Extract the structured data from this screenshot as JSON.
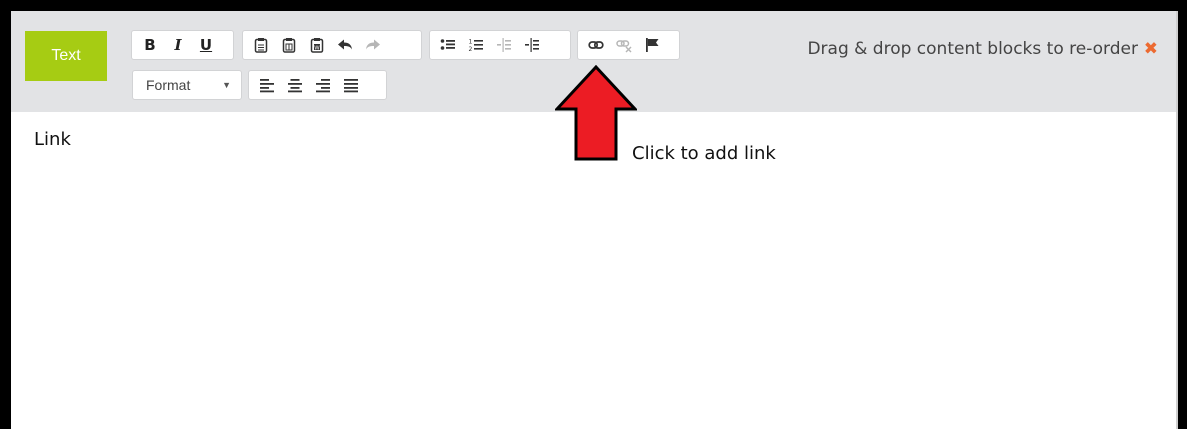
{
  "block": {
    "type_label": "Text"
  },
  "toolbar": {
    "format_label": "Format",
    "buttons": [
      {
        "name": "bold",
        "icon": "bold-icon",
        "glyph": "B"
      },
      {
        "name": "italic",
        "icon": "italic-icon",
        "glyph": "I"
      },
      {
        "name": "underline",
        "icon": "underline-icon",
        "glyph": "U"
      },
      {
        "name": "paste",
        "icon": "paste-icon"
      },
      {
        "name": "paste-text",
        "icon": "paste-text-icon"
      },
      {
        "name": "paste-word",
        "icon": "paste-word-icon"
      },
      {
        "name": "undo",
        "icon": "undo-icon"
      },
      {
        "name": "redo",
        "icon": "redo-icon",
        "disabled": true
      },
      {
        "name": "bulleted-list",
        "icon": "bulleted-list-icon"
      },
      {
        "name": "numbered-list",
        "icon": "numbered-list-icon"
      },
      {
        "name": "outdent",
        "icon": "outdent-icon",
        "disabled": true
      },
      {
        "name": "indent",
        "icon": "indent-icon"
      },
      {
        "name": "link",
        "icon": "link-icon"
      },
      {
        "name": "unlink",
        "icon": "unlink-icon",
        "disabled": true
      },
      {
        "name": "anchor",
        "icon": "flag-icon"
      },
      {
        "name": "align-left",
        "icon": "align-left-icon"
      },
      {
        "name": "align-center",
        "icon": "align-center-icon"
      },
      {
        "name": "align-right",
        "icon": "align-right-icon"
      },
      {
        "name": "justify",
        "icon": "justify-icon"
      }
    ]
  },
  "header": {
    "drag_hint": "Drag & drop content blocks to re-order",
    "close_icon": "close-icon"
  },
  "editor": {
    "content": "Link"
  },
  "annotation": {
    "callout": "Click to add link",
    "arrow_color": "#ec1c24"
  },
  "colors": {
    "accent": "#a6cc13",
    "close": "#ec6a31",
    "header_bg": "#e2e3e5"
  }
}
